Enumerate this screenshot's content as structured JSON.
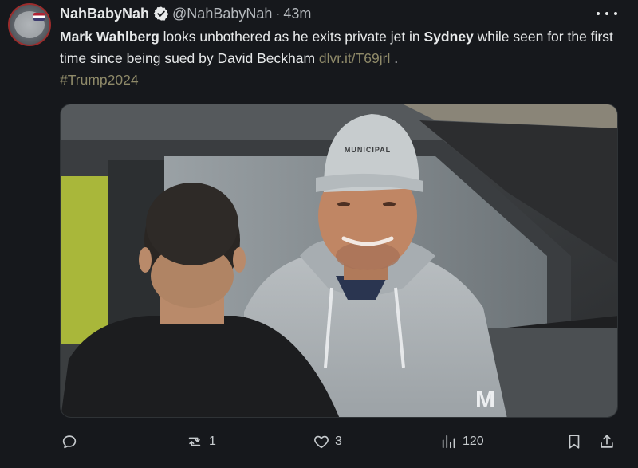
{
  "post": {
    "author": {
      "display_name": "NahBabyNah",
      "handle": "@NahBabyNah",
      "separator": "·",
      "time": "43m",
      "verified": true
    },
    "text": {
      "name": "Mark Wahlberg",
      "part1": " looks unbothered as he exits private jet in ",
      "place": "Sydney",
      "part2": " while seen for the first time since being sued by David Beckham ",
      "link": "dlvr.it/T69jrl",
      "part3": " .",
      "hashtag": "#Trump2024"
    },
    "media": {
      "cap_text": "MUNICIPAL",
      "hoodie_mark": "M"
    },
    "actions": {
      "reply": {
        "icon": "reply-icon",
        "count": ""
      },
      "repost": {
        "icon": "repost-icon",
        "count": "1"
      },
      "like": {
        "icon": "heart-icon",
        "count": "3"
      },
      "views": {
        "icon": "views-icon",
        "count": "120"
      },
      "bookmark": {
        "icon": "bookmark-icon"
      },
      "share": {
        "icon": "share-icon"
      }
    },
    "colors": {
      "background": "#16181c",
      "link": "#8f8a69",
      "verified": "#e7e9ea"
    }
  }
}
